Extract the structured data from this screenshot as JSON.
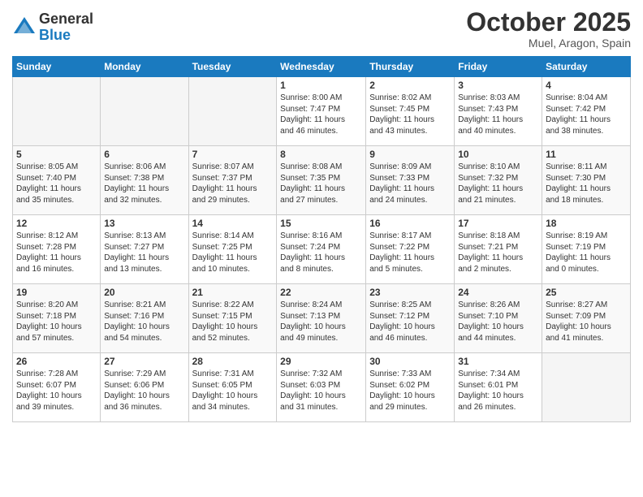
{
  "logo": {
    "general": "General",
    "blue": "Blue"
  },
  "header": {
    "month": "October 2025",
    "location": "Muel, Aragon, Spain"
  },
  "days_of_week": [
    "Sunday",
    "Monday",
    "Tuesday",
    "Wednesday",
    "Thursday",
    "Friday",
    "Saturday"
  ],
  "weeks": [
    [
      {
        "day": "",
        "info": ""
      },
      {
        "day": "",
        "info": ""
      },
      {
        "day": "",
        "info": ""
      },
      {
        "day": "1",
        "info": "Sunrise: 8:00 AM\nSunset: 7:47 PM\nDaylight: 11 hours\nand 46 minutes."
      },
      {
        "day": "2",
        "info": "Sunrise: 8:02 AM\nSunset: 7:45 PM\nDaylight: 11 hours\nand 43 minutes."
      },
      {
        "day": "3",
        "info": "Sunrise: 8:03 AM\nSunset: 7:43 PM\nDaylight: 11 hours\nand 40 minutes."
      },
      {
        "day": "4",
        "info": "Sunrise: 8:04 AM\nSunset: 7:42 PM\nDaylight: 11 hours\nand 38 minutes."
      }
    ],
    [
      {
        "day": "5",
        "info": "Sunrise: 8:05 AM\nSunset: 7:40 PM\nDaylight: 11 hours\nand 35 minutes."
      },
      {
        "day": "6",
        "info": "Sunrise: 8:06 AM\nSunset: 7:38 PM\nDaylight: 11 hours\nand 32 minutes."
      },
      {
        "day": "7",
        "info": "Sunrise: 8:07 AM\nSunset: 7:37 PM\nDaylight: 11 hours\nand 29 minutes."
      },
      {
        "day": "8",
        "info": "Sunrise: 8:08 AM\nSunset: 7:35 PM\nDaylight: 11 hours\nand 27 minutes."
      },
      {
        "day": "9",
        "info": "Sunrise: 8:09 AM\nSunset: 7:33 PM\nDaylight: 11 hours\nand 24 minutes."
      },
      {
        "day": "10",
        "info": "Sunrise: 8:10 AM\nSunset: 7:32 PM\nDaylight: 11 hours\nand 21 minutes."
      },
      {
        "day": "11",
        "info": "Sunrise: 8:11 AM\nSunset: 7:30 PM\nDaylight: 11 hours\nand 18 minutes."
      }
    ],
    [
      {
        "day": "12",
        "info": "Sunrise: 8:12 AM\nSunset: 7:28 PM\nDaylight: 11 hours\nand 16 minutes."
      },
      {
        "day": "13",
        "info": "Sunrise: 8:13 AM\nSunset: 7:27 PM\nDaylight: 11 hours\nand 13 minutes."
      },
      {
        "day": "14",
        "info": "Sunrise: 8:14 AM\nSunset: 7:25 PM\nDaylight: 11 hours\nand 10 minutes."
      },
      {
        "day": "15",
        "info": "Sunrise: 8:16 AM\nSunset: 7:24 PM\nDaylight: 11 hours\nand 8 minutes."
      },
      {
        "day": "16",
        "info": "Sunrise: 8:17 AM\nSunset: 7:22 PM\nDaylight: 11 hours\nand 5 minutes."
      },
      {
        "day": "17",
        "info": "Sunrise: 8:18 AM\nSunset: 7:21 PM\nDaylight: 11 hours\nand 2 minutes."
      },
      {
        "day": "18",
        "info": "Sunrise: 8:19 AM\nSunset: 7:19 PM\nDaylight: 11 hours\nand 0 minutes."
      }
    ],
    [
      {
        "day": "19",
        "info": "Sunrise: 8:20 AM\nSunset: 7:18 PM\nDaylight: 10 hours\nand 57 minutes."
      },
      {
        "day": "20",
        "info": "Sunrise: 8:21 AM\nSunset: 7:16 PM\nDaylight: 10 hours\nand 54 minutes."
      },
      {
        "day": "21",
        "info": "Sunrise: 8:22 AM\nSunset: 7:15 PM\nDaylight: 10 hours\nand 52 minutes."
      },
      {
        "day": "22",
        "info": "Sunrise: 8:24 AM\nSunset: 7:13 PM\nDaylight: 10 hours\nand 49 minutes."
      },
      {
        "day": "23",
        "info": "Sunrise: 8:25 AM\nSunset: 7:12 PM\nDaylight: 10 hours\nand 46 minutes."
      },
      {
        "day": "24",
        "info": "Sunrise: 8:26 AM\nSunset: 7:10 PM\nDaylight: 10 hours\nand 44 minutes."
      },
      {
        "day": "25",
        "info": "Sunrise: 8:27 AM\nSunset: 7:09 PM\nDaylight: 10 hours\nand 41 minutes."
      }
    ],
    [
      {
        "day": "26",
        "info": "Sunrise: 7:28 AM\nSunset: 6:07 PM\nDaylight: 10 hours\nand 39 minutes."
      },
      {
        "day": "27",
        "info": "Sunrise: 7:29 AM\nSunset: 6:06 PM\nDaylight: 10 hours\nand 36 minutes."
      },
      {
        "day": "28",
        "info": "Sunrise: 7:31 AM\nSunset: 6:05 PM\nDaylight: 10 hours\nand 34 minutes."
      },
      {
        "day": "29",
        "info": "Sunrise: 7:32 AM\nSunset: 6:03 PM\nDaylight: 10 hours\nand 31 minutes."
      },
      {
        "day": "30",
        "info": "Sunrise: 7:33 AM\nSunset: 6:02 PM\nDaylight: 10 hours\nand 29 minutes."
      },
      {
        "day": "31",
        "info": "Sunrise: 7:34 AM\nSunset: 6:01 PM\nDaylight: 10 hours\nand 26 minutes."
      },
      {
        "day": "",
        "info": ""
      }
    ]
  ]
}
